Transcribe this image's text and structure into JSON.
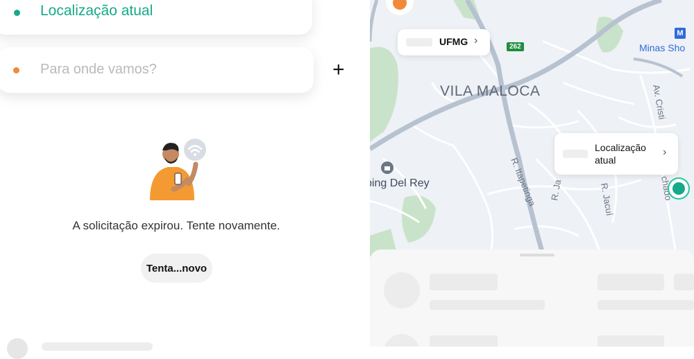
{
  "search": {
    "origin_label": "Localização atual",
    "destination_placeholder": "Para onde vamos?",
    "add_stop_symbol": "+"
  },
  "status": {
    "message": "A solicitação expirou. Tente novamente.",
    "retry_label": "Tenta...novo"
  },
  "map": {
    "destination_chip": "UFMG",
    "current_location_chip": "Localização atual",
    "neighborhood": "VILA MALOCA",
    "poi_shopping": "ping Del Rey",
    "poi_metro": "Minas Sho",
    "road_shield": "262",
    "metro_symbol": "M",
    "street_itapetinga": "R. Itapetinga",
    "street_jacui": "R. Jacuí",
    "street_ja": "R. Ja",
    "avenue_cristi": "Av. Cristi",
    "street_chado": "chado"
  },
  "colors": {
    "accent_green": "#16a98a",
    "accent_orange": "#f08a3a",
    "map_bg": "#eef1f6"
  },
  "icons": {
    "add_stop": "plus-icon",
    "chevron": "chevron-right-icon",
    "wifi": "wifi-icon",
    "metro": "metro-icon",
    "shopping": "shopping-bag-icon"
  }
}
